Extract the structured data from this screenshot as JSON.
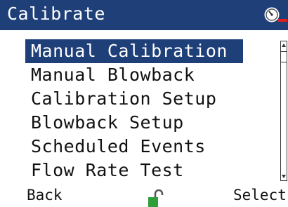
{
  "header": {
    "title": "Calibrate",
    "alarm_icon": "gauge-alarm-icon"
  },
  "menu": {
    "items": [
      {
        "label": "Manual Calibration",
        "selected": true
      },
      {
        "label": "Manual Blowback",
        "selected": false
      },
      {
        "label": "Calibration Setup",
        "selected": false
      },
      {
        "label": "Blowback Setup",
        "selected": false
      },
      {
        "label": "Scheduled Events",
        "selected": false
      },
      {
        "label": "Flow Rate Test",
        "selected": false
      }
    ]
  },
  "footer": {
    "left_softkey": "Back",
    "right_softkey": "Select",
    "lock_icon": "unlocked-padlock-icon"
  },
  "colors": {
    "header_bg": "#1f3f78",
    "selection_bg": "#1f3f78",
    "lock_green": "#2e9e3a",
    "alarm_red": "#e02020"
  }
}
